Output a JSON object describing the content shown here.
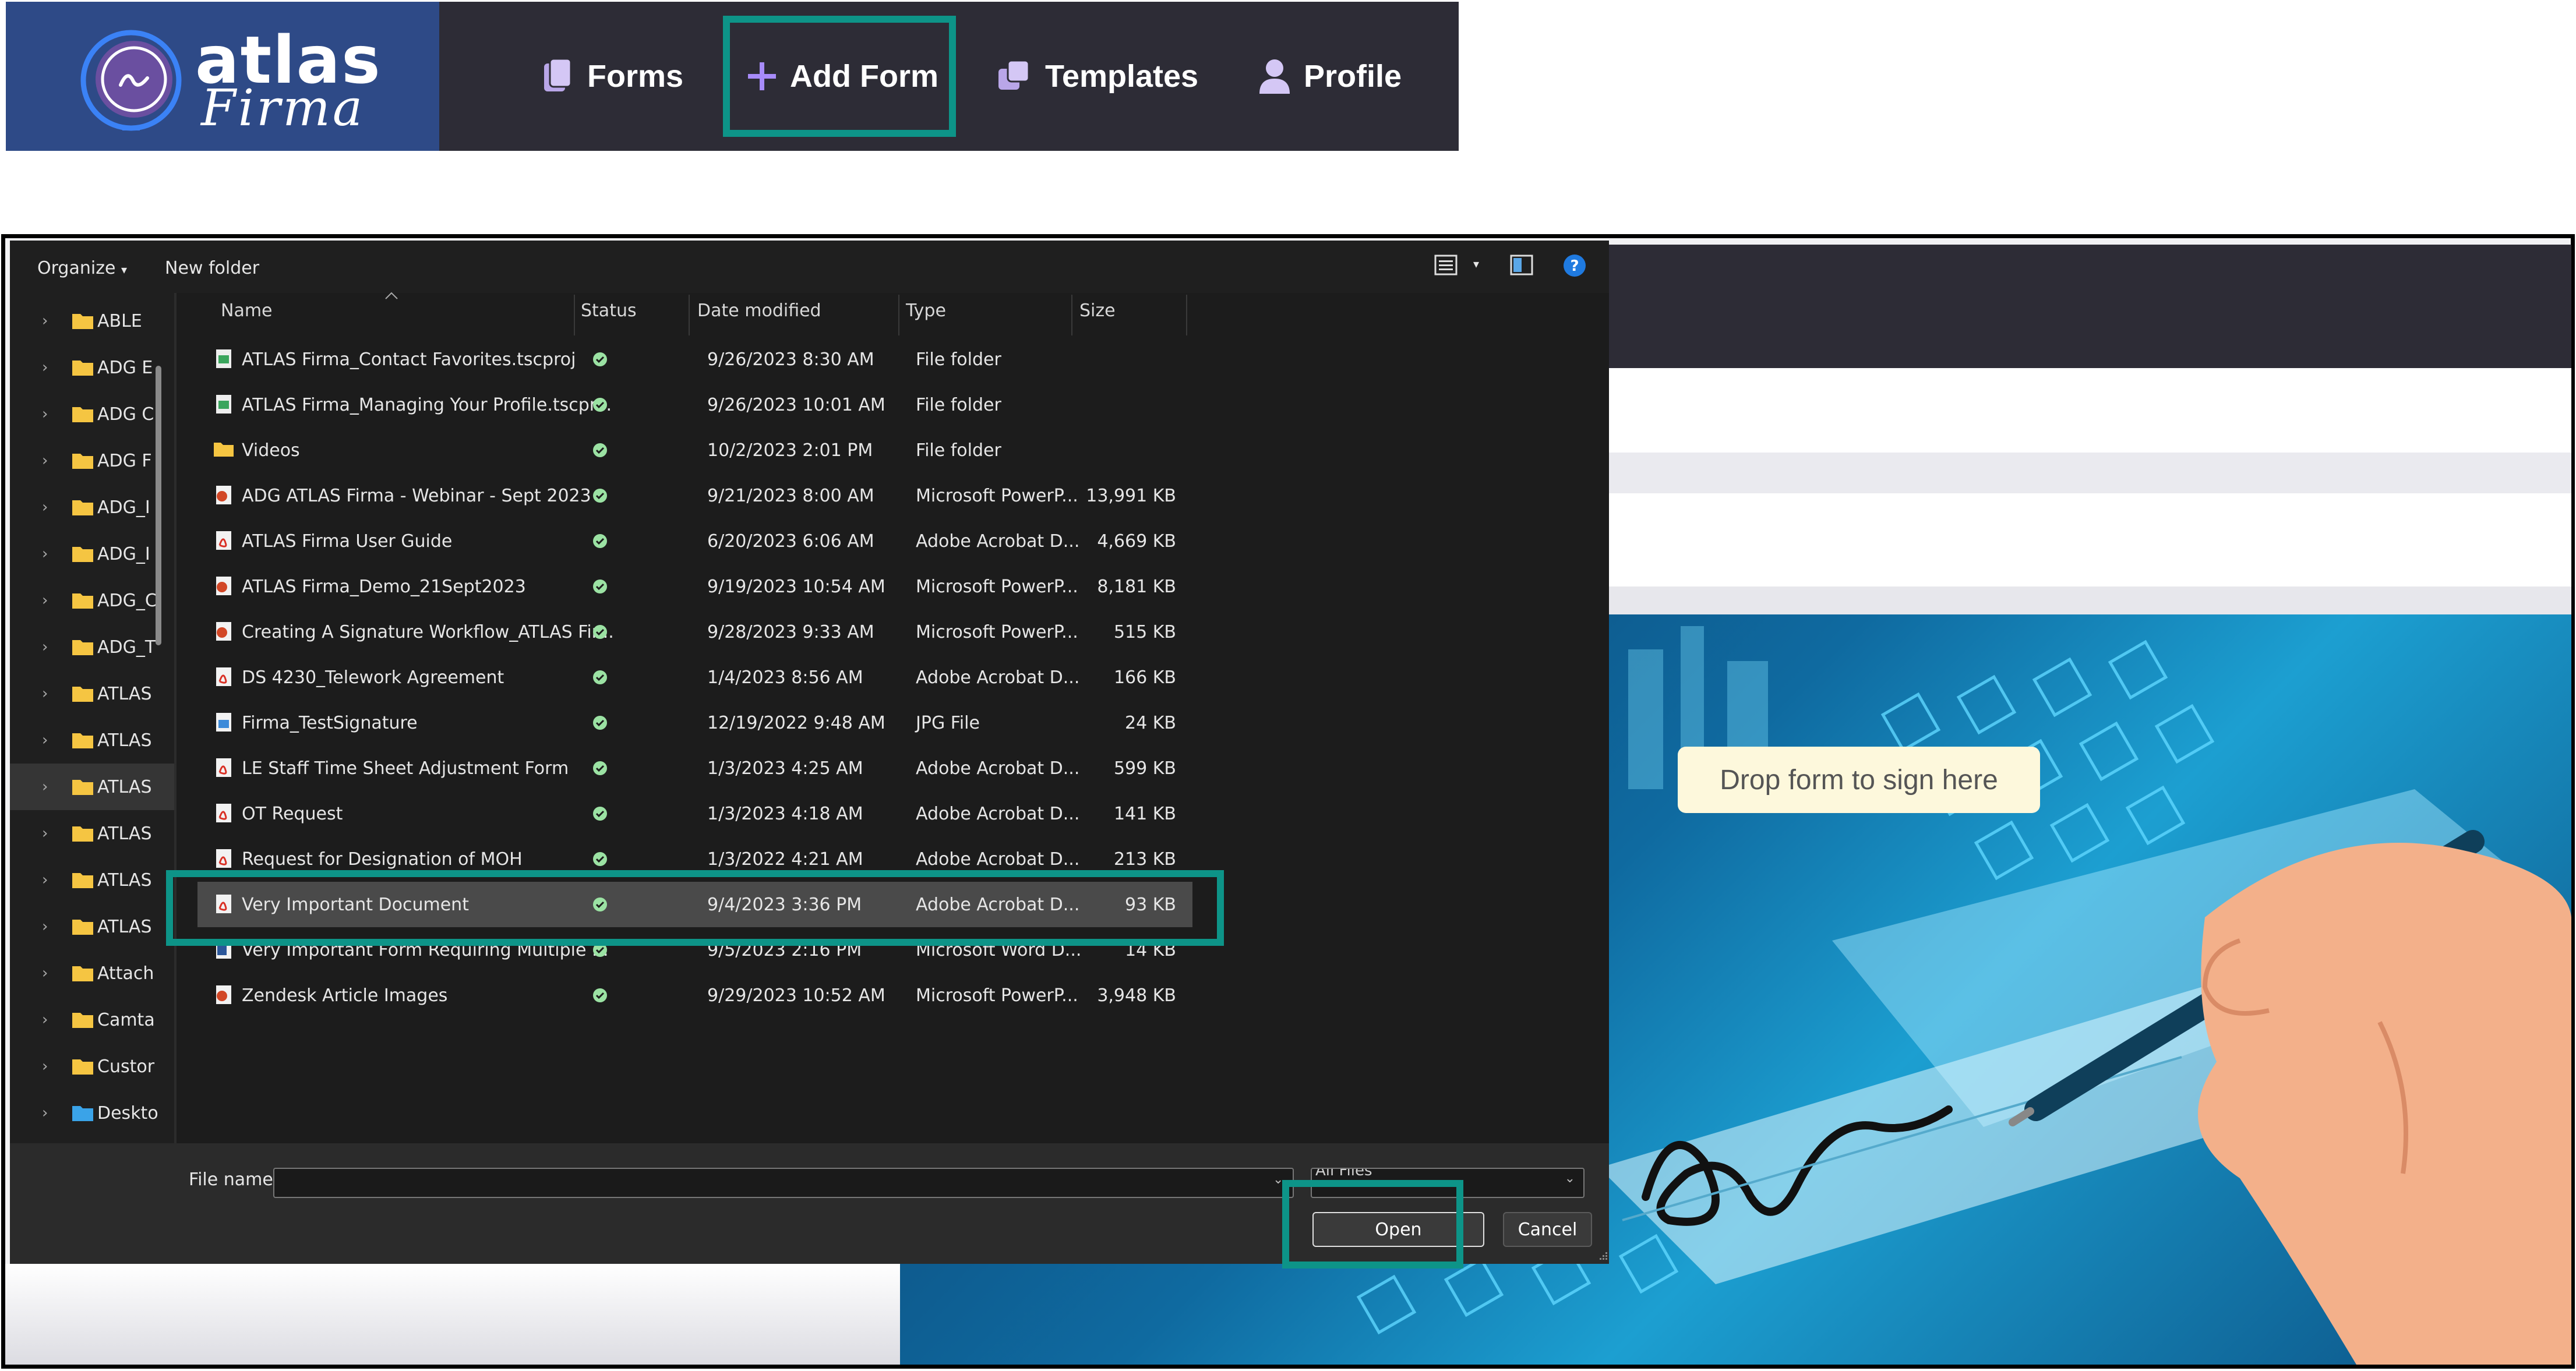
{
  "navbar": {
    "logo_word": "atlas",
    "logo_script": "Firma",
    "items": [
      {
        "label": "Forms",
        "icon": "forms-icon"
      },
      {
        "label": "Add Form",
        "icon": "plus-icon"
      },
      {
        "label": "Templates",
        "icon": "templates-icon"
      },
      {
        "label": "Profile",
        "icon": "user-icon"
      }
    ]
  },
  "background": {
    "drop_zone_text": "Drop form to sign here"
  },
  "dialog": {
    "toolbar": {
      "organize": "Organize",
      "new_folder": "New folder"
    },
    "nav_folders": [
      "ABLE",
      "ADG E",
      "ADG C",
      "ADG F",
      "ADG_I",
      "ADG_I",
      "ADG_C",
      "ADG_T",
      "ATLAS",
      "ATLAS",
      "ATLAS",
      "ATLAS",
      "ATLAS",
      "ATLAS",
      "Attach",
      "Camta",
      "Custor",
      "Deskto"
    ],
    "columns": {
      "name": "Name",
      "status": "Status",
      "date": "Date modified",
      "type": "Type",
      "size": "Size"
    },
    "files": [
      {
        "name": "ATLAS Firma_Contact Favorites.tscproj",
        "date": "9/26/2023 8:30 AM",
        "type": "File folder",
        "size": "",
        "icon": "project-icon"
      },
      {
        "name": "ATLAS Firma_Managing Your Profile.tscpr...",
        "date": "9/26/2023 10:01 AM",
        "type": "File folder",
        "size": "",
        "icon": "project-icon"
      },
      {
        "name": "Videos",
        "date": "10/2/2023 2:01 PM",
        "type": "File folder",
        "size": "",
        "icon": "folder-icon"
      },
      {
        "name": "ADG ATLAS Firma - Webinar - Sept 2023",
        "date": "9/21/2023 8:00 AM",
        "type": "Microsoft PowerP...",
        "size": "13,991 KB",
        "icon": "powerpoint-icon"
      },
      {
        "name": "ATLAS Firma User Guide",
        "date": "6/20/2023 6:06 AM",
        "type": "Adobe Acrobat D...",
        "size": "4,669 KB",
        "icon": "pdf-icon"
      },
      {
        "name": "ATLAS Firma_Demo_21Sept2023",
        "date": "9/19/2023 10:54 AM",
        "type": "Microsoft PowerP...",
        "size": "8,181 KB",
        "icon": "powerpoint-icon"
      },
      {
        "name": "Creating A Signature Workflow_ATLAS Fir...",
        "date": "9/28/2023 9:33 AM",
        "type": "Microsoft PowerP...",
        "size": "515 KB",
        "icon": "powerpoint-icon"
      },
      {
        "name": "DS 4230_Telework Agreement",
        "date": "1/4/2023 8:56 AM",
        "type": "Adobe Acrobat D...",
        "size": "166 KB",
        "icon": "pdf-icon"
      },
      {
        "name": "Firma_TestSignature",
        "date": "12/19/2022 9:48 AM",
        "type": "JPG File",
        "size": "24 KB",
        "icon": "image-icon"
      },
      {
        "name": "LE Staff Time Sheet Adjustment Form",
        "date": "1/3/2023 4:25 AM",
        "type": "Adobe Acrobat D...",
        "size": "599 KB",
        "icon": "pdf-icon"
      },
      {
        "name": "OT Request",
        "date": "1/3/2023 4:18 AM",
        "type": "Adobe Acrobat D...",
        "size": "141 KB",
        "icon": "pdf-icon"
      },
      {
        "name": "Request for Designation of MOH",
        "date": "1/3/2022 4:21 AM",
        "type": "Adobe Acrobat D...",
        "size": "213 KB",
        "icon": "pdf-icon"
      },
      {
        "name": "Very Important Document",
        "date": "9/4/2023 3:36 PM",
        "type": "Adobe Acrobat D...",
        "size": "93 KB",
        "icon": "pdf-icon",
        "selected": true
      },
      {
        "name": "Very Important Form Requiring Multiple ...",
        "date": "9/5/2023 2:16 PM",
        "type": "Microsoft Word D...",
        "size": "14 KB",
        "icon": "word-icon"
      },
      {
        "name": "Zendesk Article Images",
        "date": "9/29/2023 10:52 AM",
        "type": "Microsoft PowerP...",
        "size": "3,948 KB",
        "icon": "powerpoint-icon"
      }
    ],
    "file_name_label": "File name:",
    "file_name_value": "",
    "file_type": "All Files",
    "open_label": "Open",
    "cancel_label": "Cancel"
  },
  "colors": {
    "highlight": "#0d9488",
    "navbar": "#2d2c36",
    "logo_bg": "#2e4a87",
    "accent_purple": "#a78bfa"
  }
}
